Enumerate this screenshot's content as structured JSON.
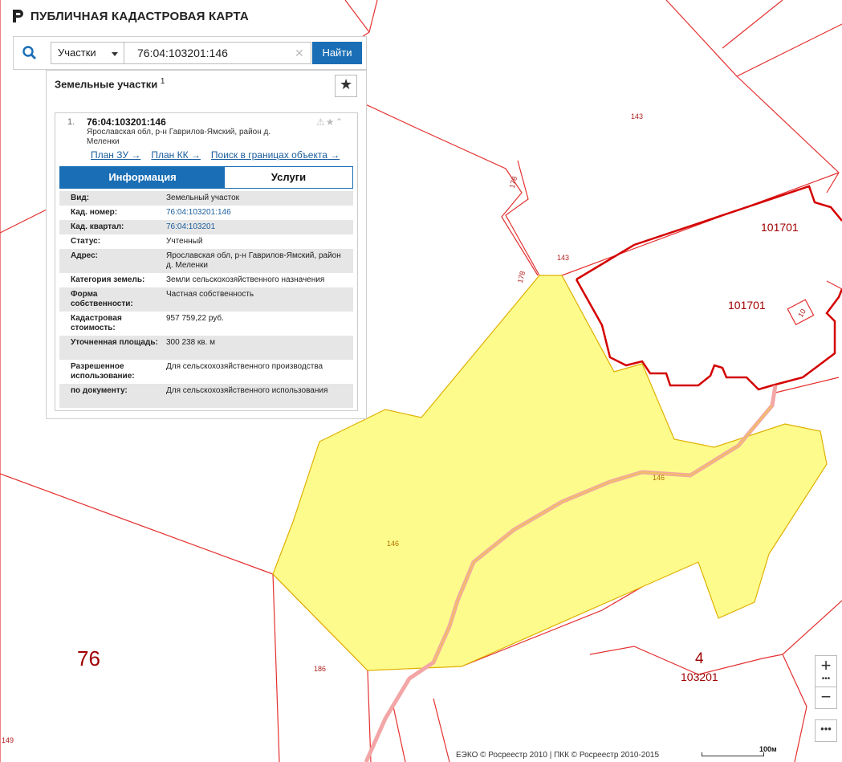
{
  "app": {
    "title": "ПУБЛИЧНАЯ КАДАСТРОВАЯ КАРТА"
  },
  "search": {
    "type": "Участки",
    "query": "76:04:103201:146",
    "find_label": "Найти"
  },
  "panel": {
    "title": "Земельные участки",
    "count": "1",
    "result": {
      "index": "1.",
      "kad_number": "76:04:103201:146",
      "address": "Ярославская обл, р-н Гаврилов-Ямский, район д. Меленки",
      "links": {
        "plan_zu": "План ЗУ →",
        "plan_kk": "План КК →",
        "search_in": "Поиск в границах объекта →"
      },
      "tabs": {
        "info": "Информация",
        "services": "Услуги"
      },
      "props": [
        {
          "k": "Вид:",
          "v": "Земельный участок"
        },
        {
          "k": "Кад. номер:",
          "v": "76:04:103201:146"
        },
        {
          "k": "Кад. квартал:",
          "v": "76:04:103201"
        },
        {
          "k": "Статус:",
          "v": "Учтенный"
        },
        {
          "k": "Адрес:",
          "v": "Ярославская обл, р-н Гаврилов-Ямский, район д. Меленки"
        },
        {
          "k": "Категория земель:",
          "v": "Земли сельскохозяйственного назначения"
        },
        {
          "k": "Форма собственности:",
          "v": "Частная собственность"
        },
        {
          "k": "Кадастровая стоимость:",
          "v": "957 759,22 руб."
        },
        {
          "k": "Уточненная площадь:",
          "v": "300 238 кв. м"
        },
        {
          "k": "Разрешенное использование:",
          "v": "Для сельскохозяйственного производства"
        },
        {
          "k": "по документу:",
          "v": "Для сельскохозяйственного использования"
        }
      ]
    }
  },
  "map_labels": {
    "l143a": "143",
    "l143b": "143",
    "l178a": "178",
    "l178b": "178",
    "q101701a": "101701",
    "q101701b": "101701",
    "l10": "10",
    "p146a": "146",
    "p146b": "146",
    "l186": "186",
    "l149": "149",
    "region": "76",
    "district": "4",
    "quarter": "103201"
  },
  "controls": {
    "zoom_in": "+",
    "zoom_out": "−",
    "dots": "•••",
    "more": "•••"
  },
  "footer": {
    "copyright": "ЕЭКО © Росреестр 2010 | ПКК © Росреестр 2010-2015",
    "scale": "100м"
  },
  "colors": {
    "parcel_fill": "#fdfb8c",
    "boundary": "#e53030",
    "quarter_boundary": "#cc0000",
    "accent": "#1a6eb5"
  }
}
